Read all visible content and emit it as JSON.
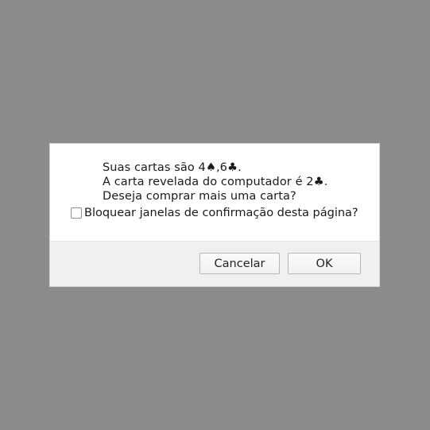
{
  "dialog": {
    "message_lines": [
      "Suas cartas são 4♠,6♣.",
      "A carta revelada do computador é 2♣.",
      "Deseja comprar mais uma carta?"
    ],
    "suppress_checkbox": {
      "label": "Bloquear janelas de confirmação desta página?",
      "checked": false
    },
    "buttons": {
      "cancel_label": "Cancelar",
      "ok_label": "OK"
    }
  },
  "colors": {
    "overlay": "#8c8c8c",
    "dialog_background": "#ffffff",
    "footer_background": "#f0f0f0"
  }
}
